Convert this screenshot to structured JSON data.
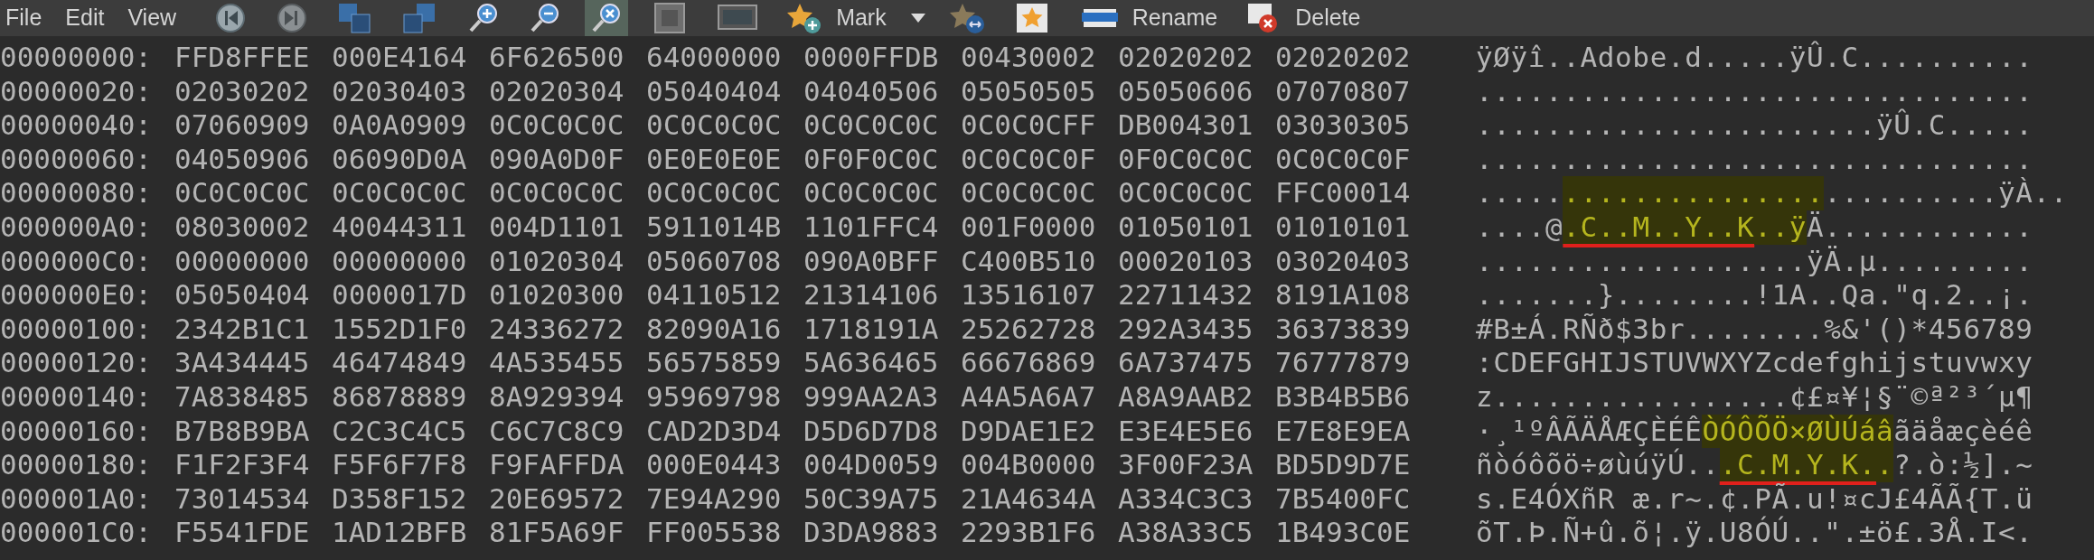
{
  "menu": [
    "File",
    "Edit",
    "View"
  ],
  "toolbar": [
    {
      "selected": false
    },
    {
      "selected": false
    },
    {
      "selected": false
    },
    {
      "selected": false
    },
    {
      "selected": false
    },
    {
      "selected": false
    },
    {
      "selected": true
    },
    {
      "selected": false
    },
    {
      "selected": false
    },
    {
      "label": "Mark",
      "selected": false,
      "dropdown": true
    },
    {
      "selected": false
    },
    {
      "selected": false
    },
    {
      "label": "Rename",
      "selected": false
    },
    {
      "label": "Delete",
      "selected": false
    }
  ],
  "rows": [
    {
      "offset": "00000000:",
      "hex": [
        "FFD8FFEE",
        "000E4164",
        "6F626500",
        "64000000",
        "0000FFDB",
        "00430002",
        "02020202",
        "02020202"
      ],
      "ascii": [
        {
          "text": "ÿØÿî..Adobe.d.....ÿÛ.C..........",
          "highlighted": false,
          "underlined": false
        }
      ]
    },
    {
      "offset": "00000020:",
      "hex": [
        "02030202",
        "02030403",
        "02020304",
        "05040404",
        "04040506",
        "05050505",
        "05050606",
        "07070807"
      ],
      "ascii": [
        {
          "text": "................................",
          "highlighted": false,
          "underlined": false
        }
      ]
    },
    {
      "offset": "00000040:",
      "hex": [
        "07060909",
        "0A0A0909",
        "0C0C0C0C",
        "0C0C0C0C",
        "0C0C0C0C",
        "0C0C0CFF",
        "DB004301",
        "03030305"
      ],
      "ascii": [
        {
          "text": ".......................ÿÛ.C.....",
          "highlighted": false,
          "underlined": false
        }
      ]
    },
    {
      "offset": "00000060:",
      "hex": [
        "04050906",
        "06090D0A",
        "090A0D0F",
        "0E0E0E0E",
        "0F0F0C0C",
        "0C0C0C0F",
        "0F0C0C0C",
        "0C0C0C0F"
      ],
      "ascii": [
        {
          "text": "................................",
          "highlighted": false,
          "underlined": false
        }
      ]
    },
    {
      "offset": "00000080:",
      "hex": [
        "0C0C0C0C",
        "0C0C0C0C",
        "0C0C0C0C",
        "0C0C0C0C",
        "0C0C0C0C",
        "0C0C0C0C",
        "0C0C0C0C",
        "FFC00014"
      ],
      "ascii": [
        {
          "text": ".....",
          "highlighted": false,
          "underlined": false
        },
        {
          "text": "...............",
          "highlighted": true,
          "underlined": false
        },
        {
          "text": "..........ÿÀ..",
          "highlighted": false,
          "underlined": false
        }
      ]
    },
    {
      "offset": "000000A0:",
      "hex": [
        "08030002",
        "40044311",
        "004D1101",
        "5911014B",
        "1101FFC4",
        "001F0000",
        "01050101",
        "01010101"
      ],
      "ascii": [
        {
          "text": "....@",
          "highlighted": false,
          "underlined": false
        },
        {
          "text": ".C..M..Y..K",
          "highlighted": true,
          "underlined": true
        },
        {
          "text": "..ÿ",
          "highlighted": true,
          "underlined": false
        },
        {
          "text": "Ä............",
          "highlighted": false,
          "underlined": false
        }
      ]
    },
    {
      "offset": "000000C0:",
      "hex": [
        "00000000",
        "00000000",
        "01020304",
        "05060708",
        "090A0BFF",
        "C400B510",
        "00020103",
        "03020403"
      ],
      "ascii": [
        {
          "text": "...................ÿÄ.µ.........",
          "highlighted": false,
          "underlined": false
        }
      ]
    },
    {
      "offset": "000000E0:",
      "hex": [
        "05050404",
        "0000017D",
        "01020300",
        "04110512",
        "21314106",
        "13516107",
        "22711432",
        "8191A108"
      ],
      "ascii": [
        {
          "text": ".......}........!1A..Qa.\"q.2..¡.",
          "highlighted": false,
          "underlined": false
        }
      ]
    },
    {
      "offset": "00000100:",
      "hex": [
        "2342B1C1",
        "1552D1F0",
        "24336272",
        "82090A16",
        "1718191A",
        "25262728",
        "292A3435",
        "36373839"
      ],
      "ascii": [
        {
          "text": "#B±Á.RÑð$3br........%&'()*456789",
          "highlighted": false,
          "underlined": false
        }
      ]
    },
    {
      "offset": "00000120:",
      "hex": [
        "3A434445",
        "46474849",
        "4A535455",
        "56575859",
        "5A636465",
        "66676869",
        "6A737475",
        "76777879"
      ],
      "ascii": [
        {
          "text": ":CDEFGHIJSTUVWXYZcdefghijstuvwxy",
          "highlighted": false,
          "underlined": false
        }
      ]
    },
    {
      "offset": "00000140:",
      "hex": [
        "7A838485",
        "86878889",
        "8A929394",
        "95969798",
        "999AA2A3",
        "A4A5A6A7",
        "A8A9AAB2",
        "B3B4B5B6"
      ],
      "ascii": [
        {
          "text": "z.................¢£¤¥¦§¨©ª²³´µ¶",
          "highlighted": false,
          "underlined": false
        }
      ]
    },
    {
      "offset": "00000160:",
      "hex": [
        "B7B8B9BA",
        "C2C3C4C5",
        "C6C7C8C9",
        "CAD2D3D4",
        "D5D6D7D8",
        "D9DAE1E2",
        "E3E4E5E6",
        "E7E8E9EA"
      ],
      "ascii": [
        {
          "text": "·¸¹ºÂÃÄÅÆÇÈÉÊ",
          "highlighted": false,
          "underlined": false
        },
        {
          "text": "ÒÓÔÕÖ×ØÙÚáâ",
          "highlighted": true,
          "underlined": false
        },
        {
          "text": "ãäåæçèéê",
          "highlighted": false,
          "underlined": false
        }
      ]
    },
    {
      "offset": "00000180:",
      "hex": [
        "F1F2F3F4",
        "F5F6F7F8",
        "F9FAFFDA",
        "000E0443",
        "004D0059",
        "004B0000",
        "3F00F23A",
        "BD5D9D7E"
      ],
      "ascii": [
        {
          "text": "ñòóôõö÷øùúÿÚ..",
          "highlighted": false,
          "underlined": false
        },
        {
          "text": ".C.M.Y.K.",
          "highlighted": true,
          "underlined": true
        },
        {
          "text": ".",
          "highlighted": true,
          "underlined": false
        },
        {
          "text": "?.ò:½].~",
          "highlighted": false,
          "underlined": false
        }
      ]
    },
    {
      "offset": "000001A0:",
      "hex": [
        "73014534",
        "D358F152",
        "20E69572",
        "7E94A290",
        "50C39A75",
        "21A4634A",
        "A334C3C3",
        "7B5400FC"
      ],
      "ascii": [
        {
          "text": "s.E4ÓXñR æ.r~.¢.PÃ.u!¤cJ£4ÃÃ{T.ü",
          "highlighted": false,
          "underlined": false
        }
      ]
    },
    {
      "offset": "000001C0:",
      "hex": [
        "F5541FDE",
        "1AD12BFB",
        "81F5A69F",
        "FF005538",
        "D3DA9883",
        "2293B1F6",
        "A38A33C5",
        "1B493C0E"
      ],
      "ascii": [
        {
          "text": "õT.Þ.Ñ+û.õ¦.ÿ.U8ÓÚ..\".±ö£.3Å.I<.",
          "highlighted": false,
          "underlined": false
        }
      ]
    }
  ]
}
